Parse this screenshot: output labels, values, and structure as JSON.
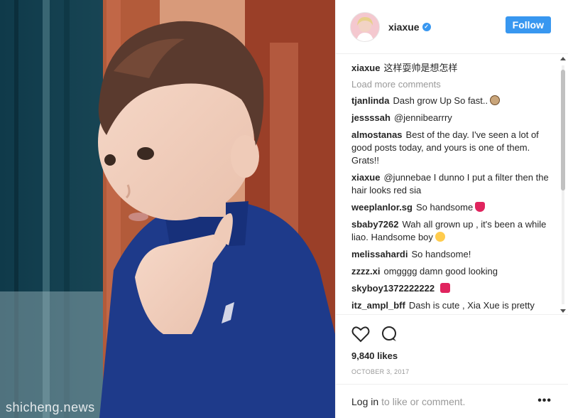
{
  "post": {
    "username": "xiaxue",
    "follow_label": "Follow",
    "caption_user": "xiaxue",
    "caption_text": "这样耍帅是想怎样",
    "load_more": "Load more comments",
    "likes": "9,840 likes",
    "date": "OCTOBER 3, 2017",
    "login_link": "Log in",
    "login_rest": "to like or comment.",
    "more_label": "•••"
  },
  "comments": [
    {
      "user": "tjanlinda",
      "text": "Dash grow Up So fast..",
      "emoji": "face-icon"
    },
    {
      "user": "jessssah",
      "text": "@jennibearrry"
    },
    {
      "user": "almostanas",
      "text": "Best of the day. I've seen a lot of good posts today, and yours is one of them. Grats!!"
    },
    {
      "user": "xiaxue",
      "text": "@junnebae I dunno I put a filter then the hair looks red sia"
    },
    {
      "user": "weeplanlor.sg",
      "text": "So handsome",
      "emoji": "broken-heart-icon"
    },
    {
      "user": "sbaby7262",
      "text": "Wah all grown up , it's been a while liao. Handsome boy",
      "emoji": "heart-eyes-icon"
    },
    {
      "user": "melissahardi",
      "text": "So handsome!"
    },
    {
      "user": "zzzz.xi",
      "text": "omgggg damn good looking"
    },
    {
      "user": "skyboy1372222222",
      "text": "",
      "emoji": "heart-box-icon"
    },
    {
      "user": "itz_ampl_bff",
      "text": "Dash is cute , Xia Xue is pretty"
    }
  ],
  "watermarks": {
    "bottom": "shicheng.news",
    "top": "shicheng.news"
  },
  "colors": {
    "accent": "#3897f0",
    "shirt": "#1e3a8a"
  }
}
